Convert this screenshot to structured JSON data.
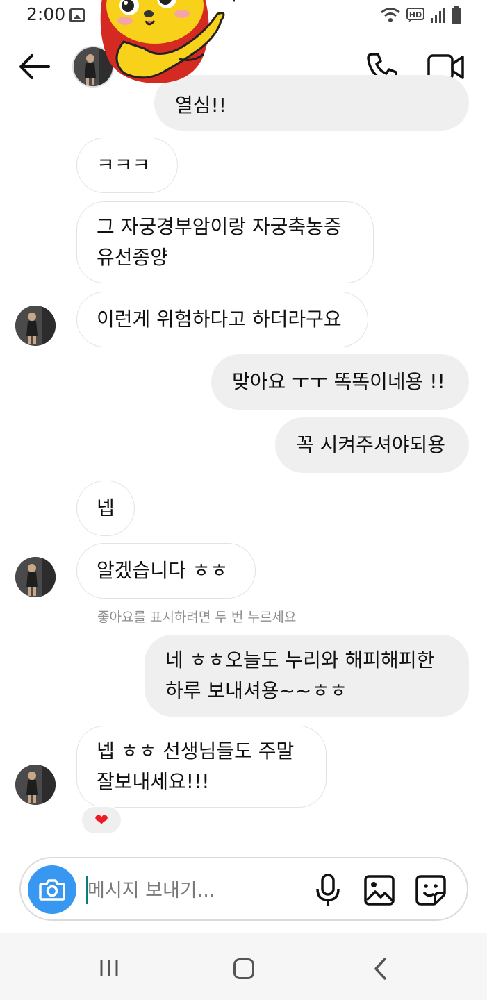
{
  "status_bar": {
    "time": "2:00",
    "icons": [
      "gallery-icon",
      "wifi-icon",
      "hd-voice-icon",
      "signal-icon",
      "battery-icon"
    ],
    "hd_label": "HD"
  },
  "header": {
    "icons": [
      "back-arrow-icon",
      "profile-avatar",
      "phone-icon",
      "video-camera-icon"
    ]
  },
  "messages": [
    {
      "side": "out",
      "text": "열심!!",
      "partial": true
    },
    {
      "side": "in",
      "text": "ㅋㅋㅋ"
    },
    {
      "side": "in",
      "text": "그 자궁경부암이랑 자궁축농증\n유선종양"
    },
    {
      "side": "in",
      "text": "이런게 위험하다고 하더라구요"
    },
    {
      "side": "out",
      "text": "맞아요 ㅜㅜ 똑똑이네용 !!"
    },
    {
      "side": "out",
      "text": "꼭 시켜주셔야되용"
    },
    {
      "side": "in",
      "text": "넵"
    },
    {
      "side": "in",
      "text": "알겠습니다 ㅎㅎ"
    },
    {
      "side": "out",
      "text": "네 ㅎㅎ오늘도 누리와 해피해피한\n하루 보내셔용~~ㅎㅎ"
    },
    {
      "side": "in",
      "text": "넵 ㅎㅎ 선생님들도 주말\n잘보내세요!!!"
    }
  ],
  "like_hint": "좋아요를 표시하려면 두 번 누르세요",
  "reaction": {
    "emoji": "❤",
    "color": "#ed1c24"
  },
  "composer": {
    "placeholder": "메시지 보내기...",
    "icons": [
      "camera-icon",
      "microphone-icon",
      "image-icon",
      "sticker-icon"
    ],
    "accent": "#3897f0"
  },
  "nav_bar": {
    "icons": [
      "recent-apps-icon",
      "home-icon",
      "back-icon"
    ]
  }
}
